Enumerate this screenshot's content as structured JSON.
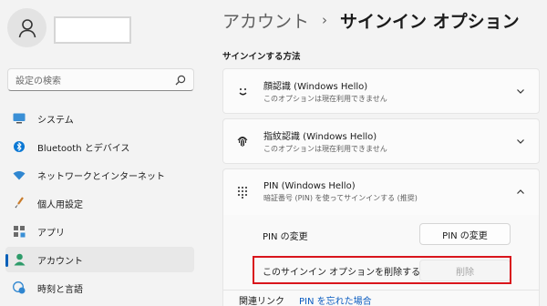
{
  "search": {
    "placeholder": "設定の検索"
  },
  "sidebar": {
    "items": [
      {
        "label": "システム",
        "icon": "monitor-icon"
      },
      {
        "label": "Bluetooth とデバイス",
        "icon": "bluetooth-icon"
      },
      {
        "label": "ネットワークとインターネット",
        "icon": "wifi-icon"
      },
      {
        "label": "個人用設定",
        "icon": "paintbrush-icon"
      },
      {
        "label": "アプリ",
        "icon": "apps-icon"
      },
      {
        "label": "アカウント",
        "icon": "account-icon",
        "active": true
      },
      {
        "label": "時刻と言語",
        "icon": "globe-clock-icon"
      }
    ]
  },
  "breadcrumb": {
    "parent": "アカウント",
    "separator": "›",
    "current": "サインイン オプション"
  },
  "section": {
    "title": "サインインする方法"
  },
  "methods": [
    {
      "title": "顔認識 (Windows Hello)",
      "subtitle": "このオプションは現在利用できません",
      "icon": "face-icon",
      "expanded": false
    },
    {
      "title": "指紋認識 (Windows Hello)",
      "subtitle": "このオプションは現在利用できません",
      "icon": "fingerprint-icon",
      "expanded": false
    },
    {
      "title": "PIN (Windows Hello)",
      "subtitle": "暗証番号 (PIN) を使ってサインインする (推奨)",
      "icon": "keypad-icon",
      "expanded": true
    }
  ],
  "pin": {
    "change_label": "PIN の変更",
    "change_button": "PIN の変更",
    "remove_label": "このサインイン オプションを削除する",
    "remove_button": "削除"
  },
  "related": {
    "label": "関連リンク",
    "link": "PIN を忘れた場合"
  },
  "colors": {
    "accent": "#005fb8",
    "highlight": "#d9151c",
    "link": "#0a5cc0"
  }
}
